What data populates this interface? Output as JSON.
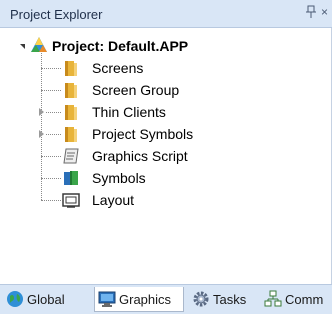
{
  "panel": {
    "title": "Project Explorer",
    "pin_glyph": "▯",
    "close_glyph": "×"
  },
  "tree": {
    "root": {
      "label": "Project: Default.APP",
      "icon": "project-icon",
      "expanded": true
    },
    "items": [
      {
        "label": "Screens",
        "icon": "folder-icon",
        "expandable": false
      },
      {
        "label": "Screen Group",
        "icon": "folder-icon",
        "expandable": false
      },
      {
        "label": "Thin Clients",
        "icon": "folder-icon",
        "expandable": true
      },
      {
        "label": "Project Symbols",
        "icon": "folder-icon",
        "expandable": true
      },
      {
        "label": "Graphics Script",
        "icon": "script-icon",
        "expandable": false
      },
      {
        "label": "Symbols",
        "icon": "symbols-icon",
        "expandable": false
      },
      {
        "label": "Layout",
        "icon": "layout-icon",
        "expandable": false
      }
    ]
  },
  "tabs": [
    {
      "label": "Global",
      "icon": "globe-icon",
      "active": false
    },
    {
      "label": "Graphics",
      "icon": "monitor-icon",
      "active": true
    },
    {
      "label": "Tasks",
      "icon": "gear-icon",
      "active": false
    },
    {
      "label": "Comm",
      "icon": "network-icon",
      "active": false
    }
  ],
  "colors": {
    "header_bg": "#d9e6f6",
    "folder": "#e8b43a",
    "active_tab_bg": "#ffffff"
  }
}
